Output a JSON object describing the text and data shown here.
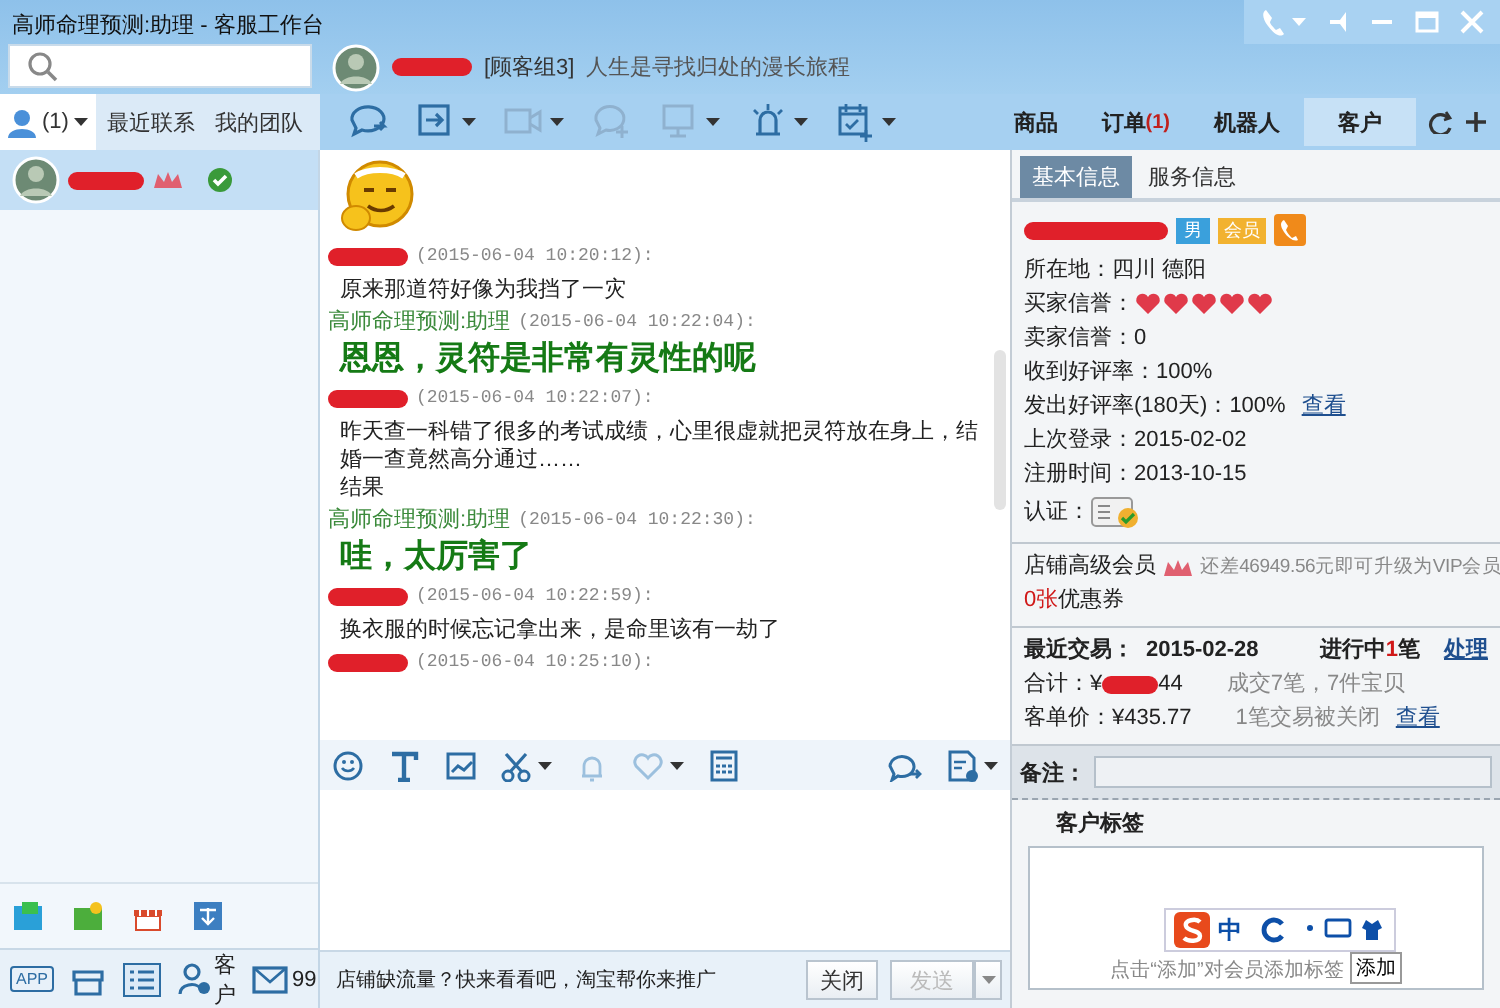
{
  "window": {
    "title": "高师命理预测:助理 - 客服工作台"
  },
  "contact_header": {
    "group": "[顾客组3]",
    "signature": "人生是寻找归处的漫长旅程"
  },
  "left_tabs": [
    {
      "kind": "contacts",
      "label": "(1)",
      "selected": true
    },
    {
      "kind": "text",
      "label": "最近联系",
      "selected": false
    },
    {
      "kind": "text",
      "label": "我的团队",
      "selected": false
    }
  ],
  "contacts": [
    {
      "selected": true,
      "online": true
    }
  ],
  "right_tabs": [
    {
      "label": "商品",
      "selected": false
    },
    {
      "label": "订单",
      "badge": "(1)",
      "selected": false
    },
    {
      "label": "机器人",
      "selected": false
    },
    {
      "label": "客户",
      "selected": true
    }
  ],
  "messages": [
    {
      "kind": "sticker"
    },
    {
      "kind": "customer",
      "time": "(2015-06-04 10:20:12):",
      "lines": [
        "原来那道符好像为我挡了一灾"
      ]
    },
    {
      "kind": "agent",
      "sender": "高师命理预测:助理",
      "time": "(2015-06-04 10:22:04):",
      "lines": [
        "恩恩，灵符是非常有灵性的呢"
      ]
    },
    {
      "kind": "customer",
      "time": "(2015-06-04 10:22:07):",
      "lines": [
        "昨天查一科错了很多的考试成绩，心里很虚就把灵符放在身上，结婚一查竟然高分通过……",
        "结果"
      ]
    },
    {
      "kind": "agent",
      "sender": "高师命理预测:助理",
      "time": "(2015-06-04 10:22:30):",
      "lines": [
        "哇，太厉害了"
      ]
    },
    {
      "kind": "customer",
      "time": "(2015-06-04 10:22:59):",
      "lines": [
        "换衣服的时候忘记拿出来，是命里该有一劫了"
      ]
    },
    {
      "kind": "customer",
      "time": "(2015-06-04 10:25:10):"
    }
  ],
  "info_tabs": [
    {
      "label": "基本信息",
      "selected": true
    },
    {
      "label": "服务信息",
      "selected": false
    }
  ],
  "profile": {
    "gender": "男",
    "member_badge": "会员"
  },
  "fields": [
    {
      "kind": "text",
      "label": "所在地：",
      "value": "四川 德阳"
    },
    {
      "kind": "hearts",
      "label": "买家信誉：",
      "stars": 5
    },
    {
      "kind": "text",
      "label": "卖家信誉：",
      "value": "0"
    },
    {
      "kind": "text",
      "label": "收到好评率：",
      "value": "100%"
    },
    {
      "kind": "link",
      "label": "发出好评率(180天)：",
      "value": "100%",
      "link": "查看"
    },
    {
      "kind": "text",
      "label": "上次登录：",
      "value": "2015-02-02"
    },
    {
      "kind": "text",
      "label": "注册时间：",
      "value": "2013-10-15"
    },
    {
      "kind": "badge",
      "label": "认证："
    }
  ],
  "membership": {
    "level": "店铺高级会员",
    "upgrade": "还差46949.56元即可升级为VIP会员",
    "coupon_count": "0张",
    "coupon_label": "优惠券"
  },
  "trade": {
    "recent_label": "最近交易：",
    "recent_date": "2015-02-28",
    "pending_prefix": "进行中",
    "pending_count": "1",
    "pending_suffix": "笔",
    "handle": "处理",
    "total_label": "合计：¥",
    "total_tail": "44",
    "deals": "成交7笔，7件宝贝",
    "unit_label": "客单价：¥435.77",
    "closed": "1笔交易被关闭",
    "view": "查看"
  },
  "remark": {
    "label": "备注："
  },
  "tags": {
    "title": "客户标签",
    "hint": "点击“添加”对会员添加标签",
    "add": "添加"
  },
  "ime": {
    "mode": "中"
  },
  "bottom_left": {
    "customers": "客户",
    "mail_count": "99",
    "app": "APP"
  },
  "promo": "店铺缺流量？快来看看吧，淘宝帮你来推广",
  "buttons": [
    {
      "label": "关闭",
      "disabled": false
    },
    {
      "label": "发送",
      "disabled": true
    }
  ]
}
